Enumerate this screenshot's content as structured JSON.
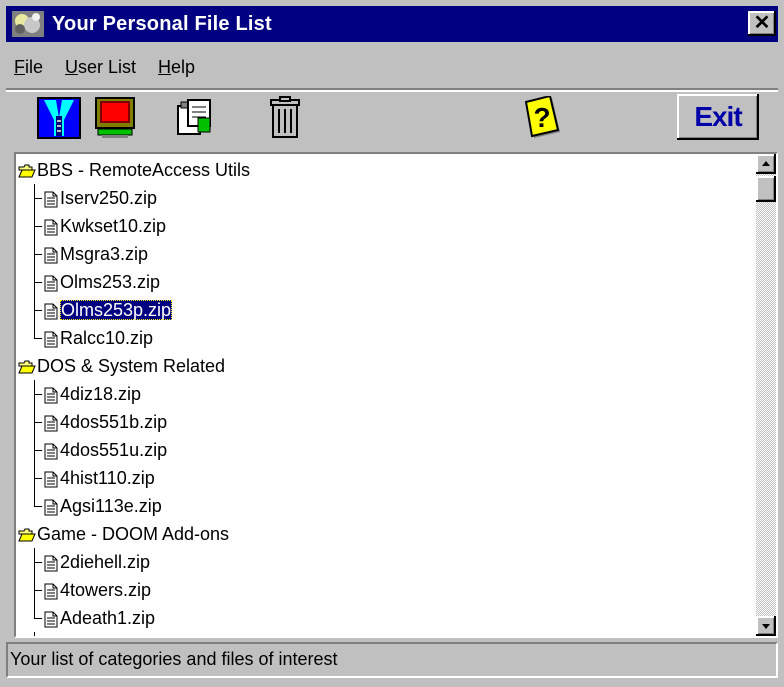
{
  "window": {
    "title": "Your Personal File List",
    "close_label": "✕"
  },
  "menu": [
    {
      "acc": "F",
      "rest": "ile"
    },
    {
      "acc": "U",
      "rest": "ser List"
    },
    {
      "acc": "H",
      "rest": "elp"
    }
  ],
  "toolbar": {
    "exit_label": "Exit"
  },
  "tree": {
    "selected": "Olms253p.zip",
    "categories": [
      {
        "name": "BBS - RemoteAccess Utils",
        "files": [
          "Iserv250.zip",
          "Kwkset10.zip",
          "Msgra3.zip",
          "Olms253.zip",
          "Olms253p.zip",
          "Ralcc10.zip"
        ]
      },
      {
        "name": "DOS & System Related",
        "files": [
          "4diz18.zip",
          "4dos551b.zip",
          "4dos551u.zip",
          "4hist110.zip",
          "Agsi113e.zip"
        ]
      },
      {
        "name": "Game - DOOM Add-ons",
        "files": [
          "2diehell.zip",
          "4towers.zip",
          "Adeath1.zip"
        ]
      }
    ]
  },
  "status": {
    "text": "Your list of categories and files of interest"
  },
  "colors": {
    "titlebar": "#000080",
    "chrome": "#c0c0c0",
    "exit_text": "#0000a8",
    "selection": "#000080"
  }
}
